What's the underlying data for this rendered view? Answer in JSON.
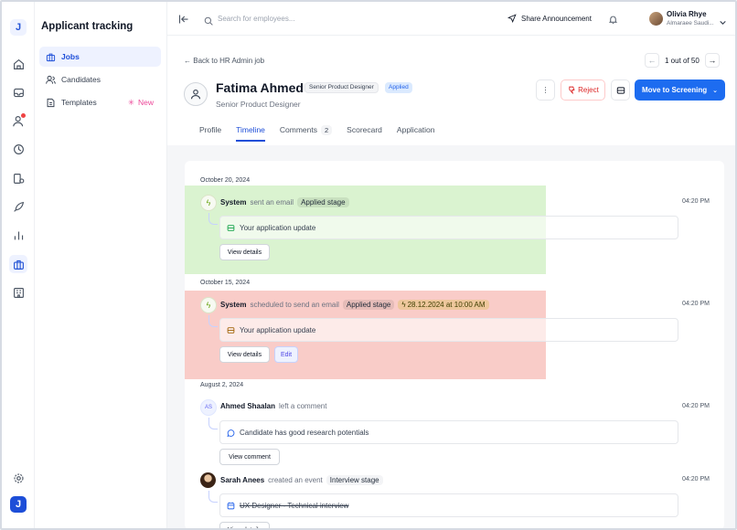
{
  "sidebar": {
    "app_title": "Applicant tracking",
    "items": [
      {
        "label": "Jobs",
        "icon": "briefcase-icon",
        "active": true
      },
      {
        "label": "Candidates",
        "icon": "users-icon"
      },
      {
        "label": "Templates",
        "icon": "file-icon",
        "badge": "New"
      }
    ]
  },
  "rail": {
    "logo": "J",
    "icons": [
      "home-icon",
      "inbox-icon",
      "user-alert-icon",
      "clock-icon",
      "database-icon",
      "rocket-icon",
      "bar-chart-icon",
      "briefcase-icon",
      "building-icon",
      "settings-icon"
    ]
  },
  "header": {
    "search_placeholder": "Search for employees...",
    "share_label": "Share Announcement",
    "user_name": "Olivia Rhye",
    "user_org": "Almaraee Saudi..."
  },
  "job": {
    "back_label": "Back to HR Admin job",
    "pager": "1 out of 50",
    "candidate_name": "Fatima Ahmed",
    "role_tag": "Senior Product Designer",
    "status_tag": "Applied",
    "role": "Senior Product Designer",
    "reject_label": "Reject",
    "move_label": "Move to Screening"
  },
  "tabs": [
    {
      "label": "Profile"
    },
    {
      "label": "Timeline",
      "active": true
    },
    {
      "label": "Comments",
      "count": "2"
    },
    {
      "label": "Scorecard"
    },
    {
      "label": "Application"
    }
  ],
  "timeline": {
    "groups": [
      {
        "date": "October 20, 2024",
        "actor": "System",
        "action": "sent an email",
        "stage": "Applied stage",
        "time": "04:20 PM",
        "detail": "Your application update",
        "button": "View details"
      },
      {
        "date": "October 15, 2024",
        "actor": "System",
        "action": "scheduled to send an email",
        "stage": "Applied stage",
        "scheduled": "28.12.2024 at 10:00 AM",
        "time": "04:20 PM",
        "detail": "Your application update",
        "button": "View details",
        "button2": "Edit"
      },
      {
        "date": "August 2, 2024",
        "actor_initials": "AS",
        "actor": "Ahmed Shaalan",
        "action": "left a comment",
        "time": "04:20 PM",
        "detail": "Candidate has good research potentials",
        "button": "View comment"
      },
      {
        "actor": "Sarah Anees",
        "action": "created an event",
        "stage": "Interview stage",
        "time": "04:20 PM",
        "detail": "UX Designer - Technical interview",
        "button": "View details"
      }
    ]
  }
}
